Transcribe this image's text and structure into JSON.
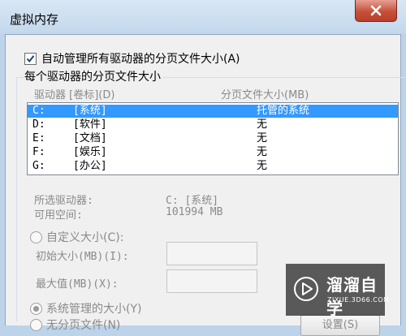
{
  "window": {
    "title": "虚拟内存"
  },
  "auto_manage": {
    "label": "自动管理所有驱动器的分页文件大小(A)",
    "checked": true
  },
  "group": {
    "title": "每个驱动器的分页文件大小",
    "columns": [
      "驱动器 [卷标](D)",
      "分页文件大小(MB)"
    ]
  },
  "drives": [
    {
      "drive": "C:",
      "label": "[系统]",
      "size": "托管的系统",
      "selected": true
    },
    {
      "drive": "D:",
      "label": "[软件]",
      "size": "无",
      "selected": false
    },
    {
      "drive": "E:",
      "label": "[文档]",
      "size": "无",
      "selected": false
    },
    {
      "drive": "F:",
      "label": "[娱乐]",
      "size": "无",
      "selected": false
    },
    {
      "drive": "G:",
      "label": "[办公]",
      "size": "无",
      "selected": false
    }
  ],
  "selected_info": {
    "drive_label": "所选驱动器:",
    "drive_value": "C:  [系统]",
    "space_label": "可用空间:",
    "space_value": "101994 MB"
  },
  "custom_size": {
    "label": "自定义大小(C):",
    "initial_label": "初始大小(MB)(I):",
    "initial_value": "",
    "max_label": "最大值(MB)(X):",
    "max_value": ""
  },
  "system_managed": {
    "label": "系统管理的大小(Y)",
    "selected": true
  },
  "no_paging": {
    "label": "无分页文件(N)"
  },
  "set_button": "设置(S)",
  "watermark": {
    "main": "溜溜自学",
    "sub": "ZIXUE.3D66.COM"
  }
}
